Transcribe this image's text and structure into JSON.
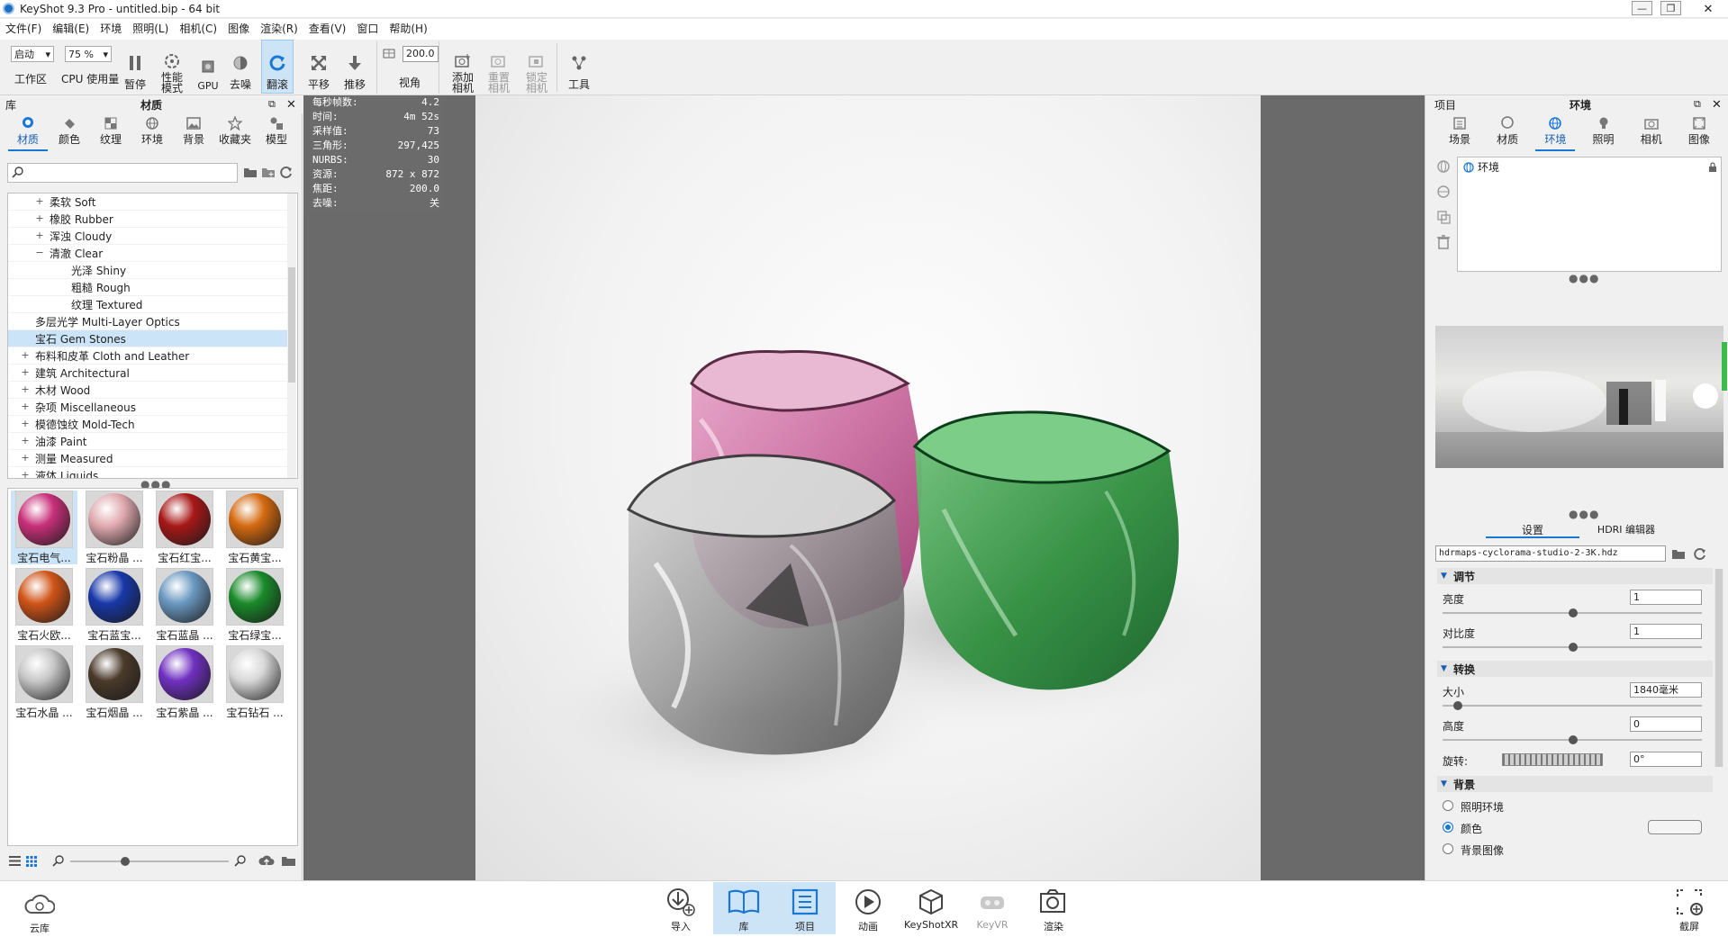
{
  "window": {
    "title": "KeyShot 9.3 Pro  - untitled.bip  - 64 bit"
  },
  "menu": [
    "文件(F)",
    "编辑(E)",
    "环境",
    "照明(L)",
    "相机(C)",
    "图像",
    "渲染(R)",
    "查看(V)",
    "窗口",
    "帮助(H)"
  ],
  "toolbar": {
    "workspace_value": "启动",
    "workspace_label": "工作区",
    "cpu_value": "75 %",
    "cpu_label": "CPU 使用量",
    "pause_label": "暂停",
    "perf_label": "性能\n模式",
    "gpu_label": "GPU",
    "denoise_label": "去噪",
    "tumble_label": "翻滚",
    "pan_label": "平移",
    "dolly_label": "推移",
    "fov_value": "200.0",
    "fov_label": "视角",
    "add_camera_label": "添加\n相机",
    "reset_camera_label": "重置\n相机",
    "lock_camera_label": "锁定\n相机",
    "tools_label": "工具"
  },
  "library": {
    "header": "库",
    "title": "材质",
    "tabs": [
      "材质",
      "颜色",
      "纹理",
      "环境",
      "背景",
      "收藏夹",
      "模型"
    ],
    "search_placeholder": "",
    "tree": [
      {
        "label": "柔软 Soft",
        "indent": 2,
        "sign": "+"
      },
      {
        "label": "橡胶 Rubber",
        "indent": 2,
        "sign": "+"
      },
      {
        "label": "浑浊 Cloudy",
        "indent": 2,
        "sign": "+"
      },
      {
        "label": "清澈 Clear",
        "indent": 2,
        "sign": "−"
      },
      {
        "label": "光泽 Shiny",
        "indent": 3,
        "sign": ""
      },
      {
        "label": "粗糙 Rough",
        "indent": 3,
        "sign": ""
      },
      {
        "label": "纹理 Textured",
        "indent": 3,
        "sign": ""
      },
      {
        "label": "多层光学 Multi-Layer Optics",
        "indent": 1,
        "sign": ""
      },
      {
        "label": "宝石 Gem Stones",
        "indent": 1,
        "sign": "",
        "selected": true
      },
      {
        "label": "布料和皮革 Cloth and Leather",
        "indent": 1,
        "sign": "+"
      },
      {
        "label": "建筑 Architectural",
        "indent": 1,
        "sign": "+"
      },
      {
        "label": "木材 Wood",
        "indent": 1,
        "sign": "+"
      },
      {
        "label": "杂项 Miscellaneous",
        "indent": 1,
        "sign": "+"
      },
      {
        "label": "模德蚀纹 Mold-Tech",
        "indent": 1,
        "sign": "+"
      },
      {
        "label": "油漆 Paint",
        "indent": 1,
        "sign": "+"
      },
      {
        "label": "测量 Measured",
        "indent": 1,
        "sign": "+"
      },
      {
        "label": "液体 Liquids",
        "indent": 1,
        "sign": "+"
      }
    ],
    "materials": [
      {
        "label": "宝石电气...",
        "color": "#c8307a",
        "selected": true
      },
      {
        "label": "宝石粉晶 ...",
        "color": "#e0aab0"
      },
      {
        "label": "宝石红宝...",
        "color": "#a81818"
      },
      {
        "label": "宝石黄宝...",
        "color": "#d46a10"
      },
      {
        "label": "宝石火欧...",
        "color": "#d05418"
      },
      {
        "label": "宝石蓝宝...",
        "color": "#1838a8"
      },
      {
        "label": "宝石蓝晶 ...",
        "color": "#6a98c0"
      },
      {
        "label": "宝石绿宝...",
        "color": "#1a8a2a"
      },
      {
        "label": "宝石水晶 ...",
        "color": "#c8c8c8"
      },
      {
        "label": "宝石烟晶 ...",
        "color": "#4a3a2a"
      },
      {
        "label": "宝石紫晶 ...",
        "color": "#7030c0"
      },
      {
        "label": "宝石钻石 ...",
        "color": "#d8d8d8"
      }
    ]
  },
  "hud": [
    {
      "k": "每秒帧数:",
      "v": "4.2"
    },
    {
      "k": "时间:",
      "v": "4m 52s"
    },
    {
      "k": "采样值:",
      "v": "73"
    },
    {
      "k": "三角形:",
      "v": "297,425"
    },
    {
      "k": "NURBS:",
      "v": "30"
    },
    {
      "k": "资源:",
      "v": "872 x 872"
    },
    {
      "k": "焦距:",
      "v": "200.0"
    },
    {
      "k": "去噪:",
      "v": "关"
    }
  ],
  "project": {
    "header": "项目",
    "title": "环境",
    "tabs": [
      "场景",
      "材质",
      "环境",
      "照明",
      "相机",
      "图像"
    ],
    "env_item": "环境",
    "subtabs": [
      "设置",
      "HDRI 编辑器"
    ],
    "hdri_file": "hdrmaps-cyclorama-studio-2-3K.hdz",
    "adjust": {
      "header": "调节",
      "brightness_label": "亮度",
      "brightness": "1",
      "contrast_label": "对比度",
      "contrast": "1"
    },
    "transform": {
      "header": "转换",
      "size_label": "大小",
      "size": "1840毫米",
      "height_label": "高度",
      "height": "0",
      "rotation_label": "旋转:",
      "rotation": "0°"
    },
    "background": {
      "header": "背景",
      "opt1": "照明环境",
      "opt2": "颜色",
      "opt3": "背景图像"
    }
  },
  "bottom": {
    "cloud": "云库",
    "import": "导入",
    "library": "库",
    "project": "项目",
    "animation": "动画",
    "keyshotxr": "KeyShotXR",
    "keyvr": "KeyVR",
    "render": "渲染",
    "screenshot": "截屏"
  }
}
